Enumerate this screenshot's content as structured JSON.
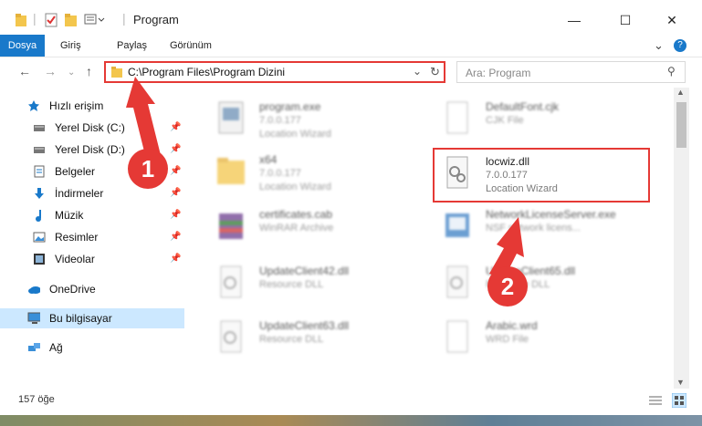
{
  "window": {
    "title": "Program",
    "controls": {
      "minimize": "—",
      "maximize": "☐",
      "close": "✕"
    }
  },
  "ribbon": {
    "tabs": [
      "Dosya",
      "Giriş",
      "Paylaş",
      "Görünüm"
    ],
    "help_icon": "?"
  },
  "address": {
    "path": "C:\\Program Files\\Program Dizini",
    "search_placeholder": "Ara: Program"
  },
  "nav_pane": {
    "items": [
      {
        "label": "Hızlı erişim",
        "icon": "star-icon",
        "pinned": false
      },
      {
        "label": "Yerel Disk (C:)",
        "icon": "drive-icon",
        "pinned": true
      },
      {
        "label": "Yerel Disk (D:)",
        "icon": "drive-icon",
        "pinned": true
      },
      {
        "label": "Belgeler",
        "icon": "documents-icon",
        "pinned": true
      },
      {
        "label": "İndirmeler",
        "icon": "download-icon",
        "pinned": true
      },
      {
        "label": "Müzik",
        "icon": "music-icon",
        "pinned": true
      },
      {
        "label": "Resimler",
        "icon": "pictures-icon",
        "pinned": true
      },
      {
        "label": "Videolar",
        "icon": "video-icon",
        "pinned": true
      },
      {
        "label": "OneDrive",
        "icon": "cloud-icon",
        "pinned": false
      },
      {
        "label": "Bu bilgisayar",
        "icon": "computer-icon",
        "pinned": false
      },
      {
        "label": "Ağ",
        "icon": "network-icon",
        "pinned": false
      }
    ]
  },
  "files": [
    {
      "name": "program.exe",
      "line2": "7.0.0.177",
      "line3": "Location Wizard"
    },
    {
      "name": "DefaultFont.cjk",
      "line2": "CJK File",
      "line3": ""
    },
    {
      "name": "x64",
      "line2": "7.0.0.177",
      "line3": "Location Wizard"
    },
    {
      "name": "locwiz.dll",
      "line2": "7.0.0.177",
      "line3": "Location Wizard"
    },
    {
      "name": "certificates.cab",
      "line2": "WinRAR Archive",
      "line3": ""
    },
    {
      "name": "NetworkLicenseServer.exe",
      "line2": "NSF network licens...",
      "line3": ""
    },
    {
      "name": "UpdateClient42.dll",
      "line2": "Resource DLL",
      "line3": ""
    },
    {
      "name": "UpdateClient65.dll",
      "line2": "Resource DLL",
      "line3": ""
    },
    {
      "name": "UpdateClient63.dll",
      "line2": "Resource DLL",
      "line3": ""
    },
    {
      "name": "Arabic.wrd",
      "line2": "WRD File",
      "line3": ""
    }
  ],
  "markers": {
    "one": "1",
    "two": "2"
  },
  "status": {
    "count": "157 öğe"
  },
  "colors": {
    "accent": "#1979ca",
    "highlight": "#e53935",
    "selected_bg": "#cce8ff"
  }
}
